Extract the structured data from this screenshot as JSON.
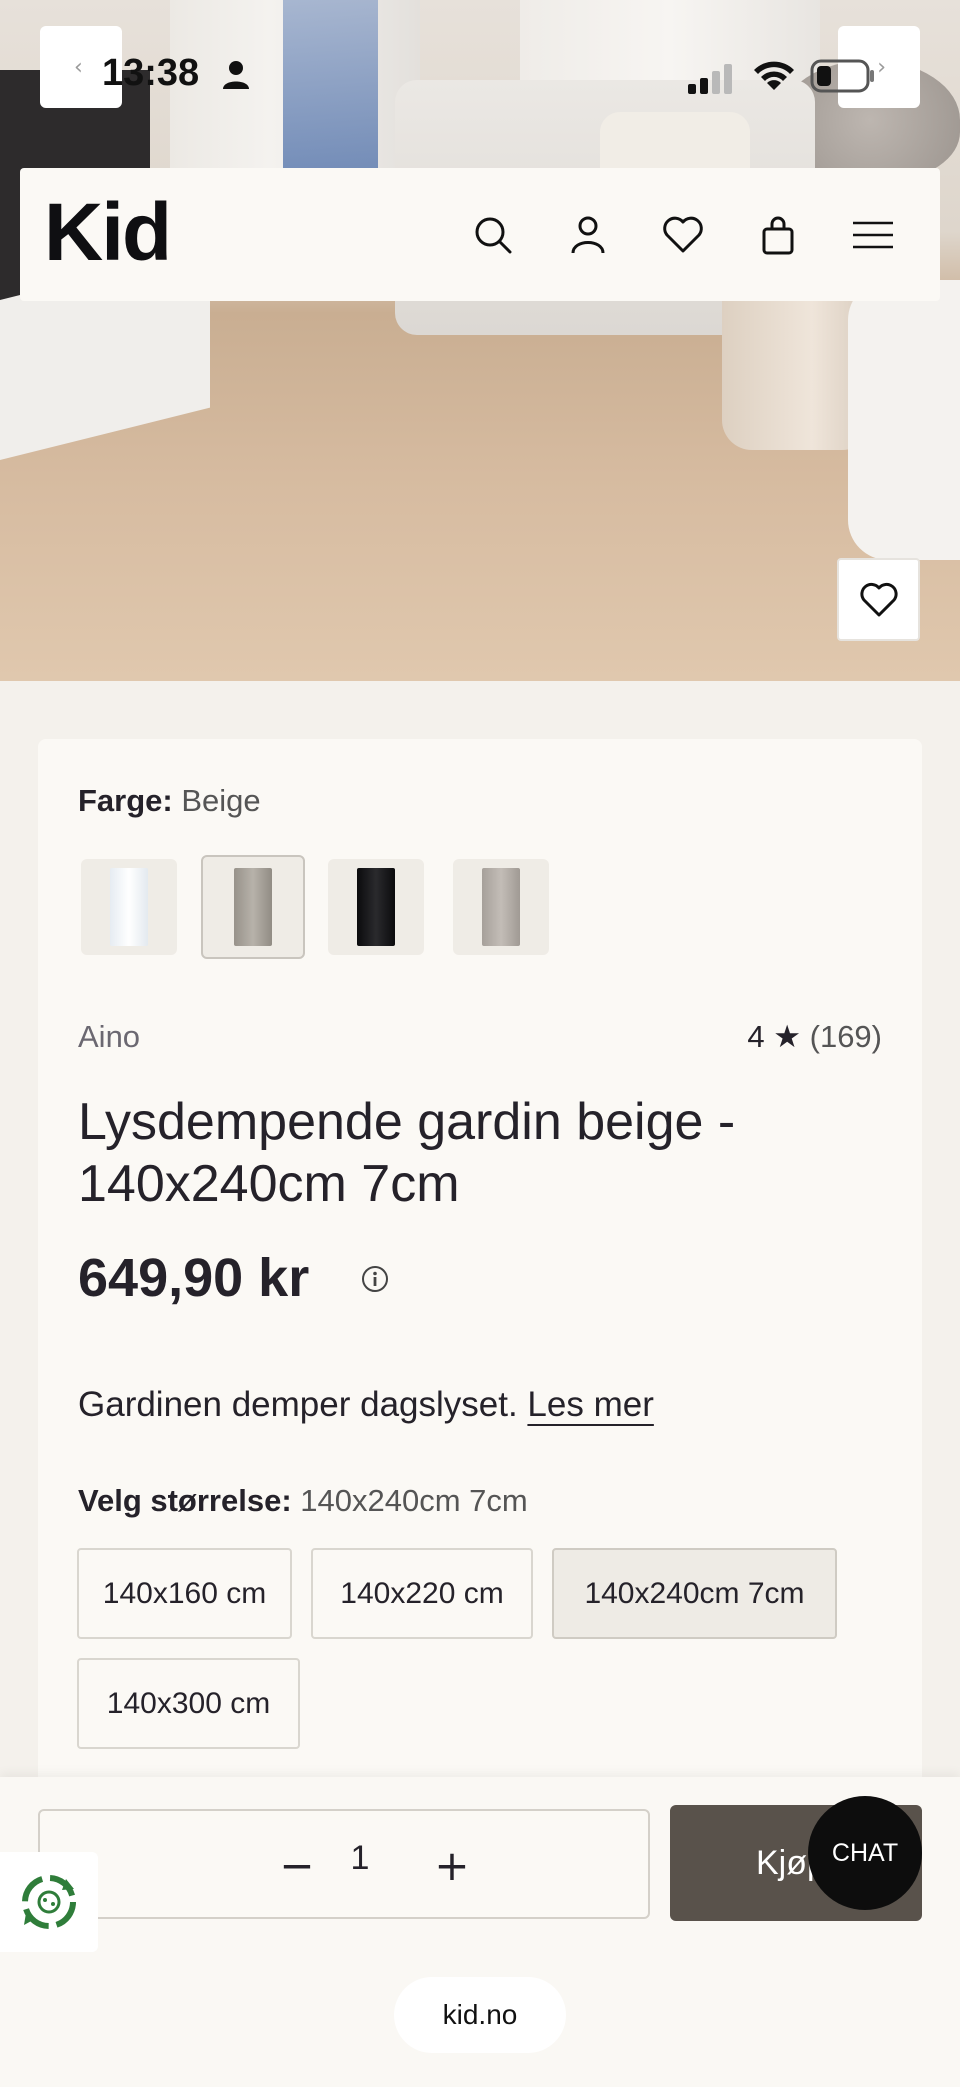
{
  "status_bar": {
    "time": "13:38"
  },
  "browser_nav": {
    "back_glyph": "‹",
    "forward_glyph": "›"
  },
  "header": {
    "logo": "Kid",
    "icons": [
      "search-icon",
      "account-icon",
      "wishlist-heart-icon",
      "cart-bag-icon",
      "menu-icon"
    ]
  },
  "product": {
    "color_label": "Farge:",
    "color_value": "Beige",
    "swatches": [
      {
        "name": "white",
        "color": "#f3f6f8"
      },
      {
        "name": "beige",
        "color": "#a8a39b",
        "selected": true
      },
      {
        "name": "black",
        "color": "#141416"
      },
      {
        "name": "grey",
        "color": "#b7b1ab"
      }
    ],
    "brand": "Aino",
    "rating_value": "4",
    "rating_star": "★",
    "rating_count": "(169)",
    "title": "Lysdempende gardin beige - 140x240cm 7cm",
    "price": "649,90 kr",
    "description": "Gardinen demper dagslyset.",
    "read_more": "Les mer",
    "size_label": "Velg størrelse:",
    "size_value": "140x240cm 7cm",
    "sizes": [
      {
        "label": "140x160 cm",
        "selected": false
      },
      {
        "label": "140x220 cm",
        "selected": false
      },
      {
        "label": "140x240cm 7cm",
        "selected": true
      },
      {
        "label": "140x300 cm",
        "selected": false
      }
    ]
  },
  "purchase": {
    "minus": "−",
    "quantity": "1",
    "plus": "+",
    "buy_label": "Kjøp",
    "chat_label": "CHAT"
  },
  "browser": {
    "url": "kid.no"
  },
  "colors": {
    "page_bg": "#f4f1ec",
    "card_bg": "#fbf9f5",
    "buy_button": "#59524b",
    "chat_button": "#0d0d0d",
    "recycle_green": "#2f7d3a"
  }
}
